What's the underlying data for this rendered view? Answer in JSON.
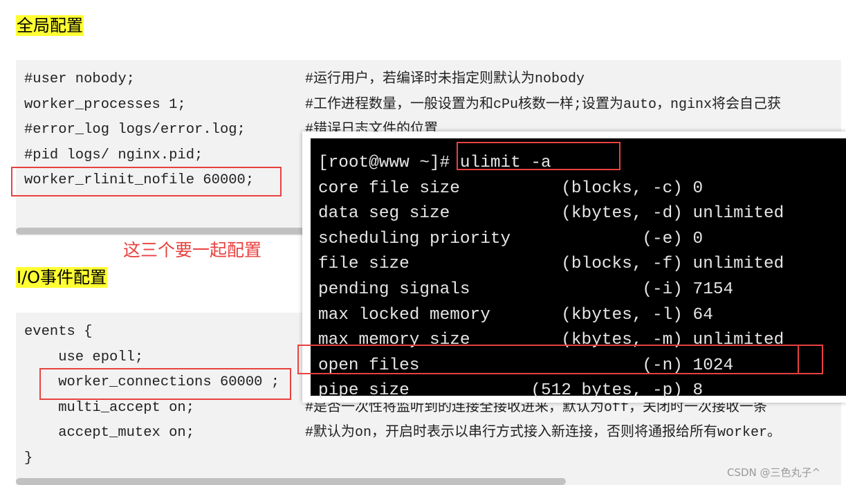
{
  "sections": {
    "global": "全局配置",
    "io": "I/O事件配置"
  },
  "note": "这三个要一起配置",
  "global_code": [
    {
      "code": "#user nobody;",
      "comment": "#运行用户，若编译时未指定则默认为nobody"
    },
    {
      "code": "worker_processes 1;",
      "comment": "#工作进程数量，一般设置为和cPu核数一样;设置为auto，nginx将会自己获"
    },
    {
      "code": "#error_log logs/error.log;",
      "comment": "#错误日志文件的位置"
    },
    {
      "code": "#pid logs/ nginx.pid;",
      "comment": ""
    },
    {
      "code": "worker_rlinit_nofile 60000;",
      "comment": ""
    }
  ],
  "events_code": [
    {
      "code": "events {",
      "comment": ""
    },
    {
      "code": "    use epoll;",
      "comment": ""
    },
    {
      "code": "    worker_connections 60000 ;",
      "comment": ""
    },
    {
      "code": "    multi_accept on;",
      "comment": "#是否一次性将监听到的连接全接收进来，默认为off，关闭时一次接收一条"
    },
    {
      "code": "    accept_mutex on;",
      "comment": "#默认为on，开启时表示以串行方式接入新连接，否则将通报给所有worker。"
    },
    {
      "code": "}",
      "comment": ""
    }
  ],
  "terminal": {
    "prompt": "[root@www ~]# ",
    "command": "ulimit -a",
    "lines": [
      "core file size          (blocks, -c) 0",
      "data seg size           (kbytes, -d) unlimited",
      "scheduling priority             (-e) 0",
      "file size               (blocks, -f) unlimited",
      "pending signals                 (-i) 7154",
      "max locked memory       (kbytes, -l) 64",
      "max memory size         (kbytes, -m) unlimited",
      "open files                      (-n) 1024",
      "pipe size            (512 bytes, -p) 8"
    ]
  },
  "watermark": "CSDN @三色丸子^",
  "colors": {
    "highlight": "#ffff33",
    "annotation": "#e8413f",
    "code_bg": "#f2f2f2",
    "terminal_bg": "#000000"
  }
}
